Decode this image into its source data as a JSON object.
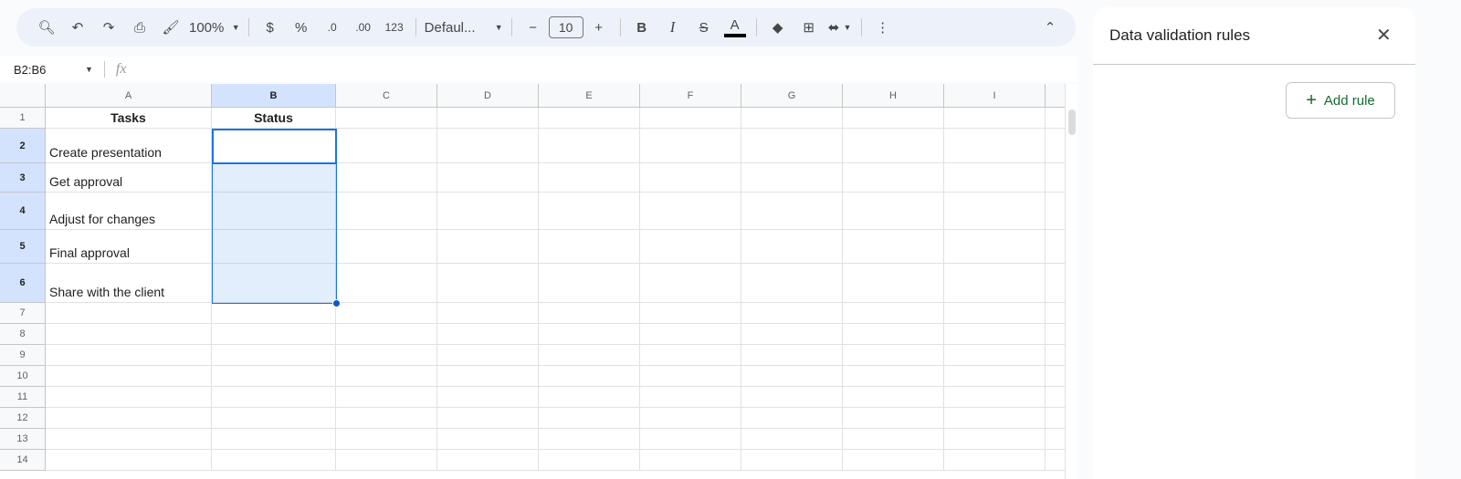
{
  "toolbar": {
    "zoom": "100%",
    "currency": "$",
    "percent": "%",
    "dec_decrease": ".0",
    "dec_increase": ".00",
    "number_format": "123",
    "font": "Defaul...",
    "font_size": "10",
    "bold": "B",
    "italic": "I",
    "text_color": "A"
  },
  "formula_bar": {
    "name_box": "B2:B6",
    "fx": "fx",
    "value": ""
  },
  "columns": [
    "A",
    "B",
    "C",
    "D",
    "E",
    "F",
    "G",
    "H",
    "I"
  ],
  "rows": [
    {
      "n": "1",
      "A": "Tasks",
      "B": "Status"
    },
    {
      "n": "2",
      "A": "Create presentation",
      "B": ""
    },
    {
      "n": "3",
      "A": "Get approval",
      "B": ""
    },
    {
      "n": "4",
      "A": "Adjust for changes",
      "B": ""
    },
    {
      "n": "5",
      "A": "Final approval",
      "B": ""
    },
    {
      "n": "6",
      "A": "Share with the client",
      "B": ""
    },
    {
      "n": "7"
    },
    {
      "n": "8"
    },
    {
      "n": "9"
    },
    {
      "n": "10"
    },
    {
      "n": "11"
    },
    {
      "n": "12"
    },
    {
      "n": "13"
    },
    {
      "n": "14"
    }
  ],
  "panel": {
    "title": "Data validation rules",
    "add_rule": "Add rule"
  },
  "colors": {
    "accent": "#1a73e8",
    "add_rule": "#146c2e"
  }
}
